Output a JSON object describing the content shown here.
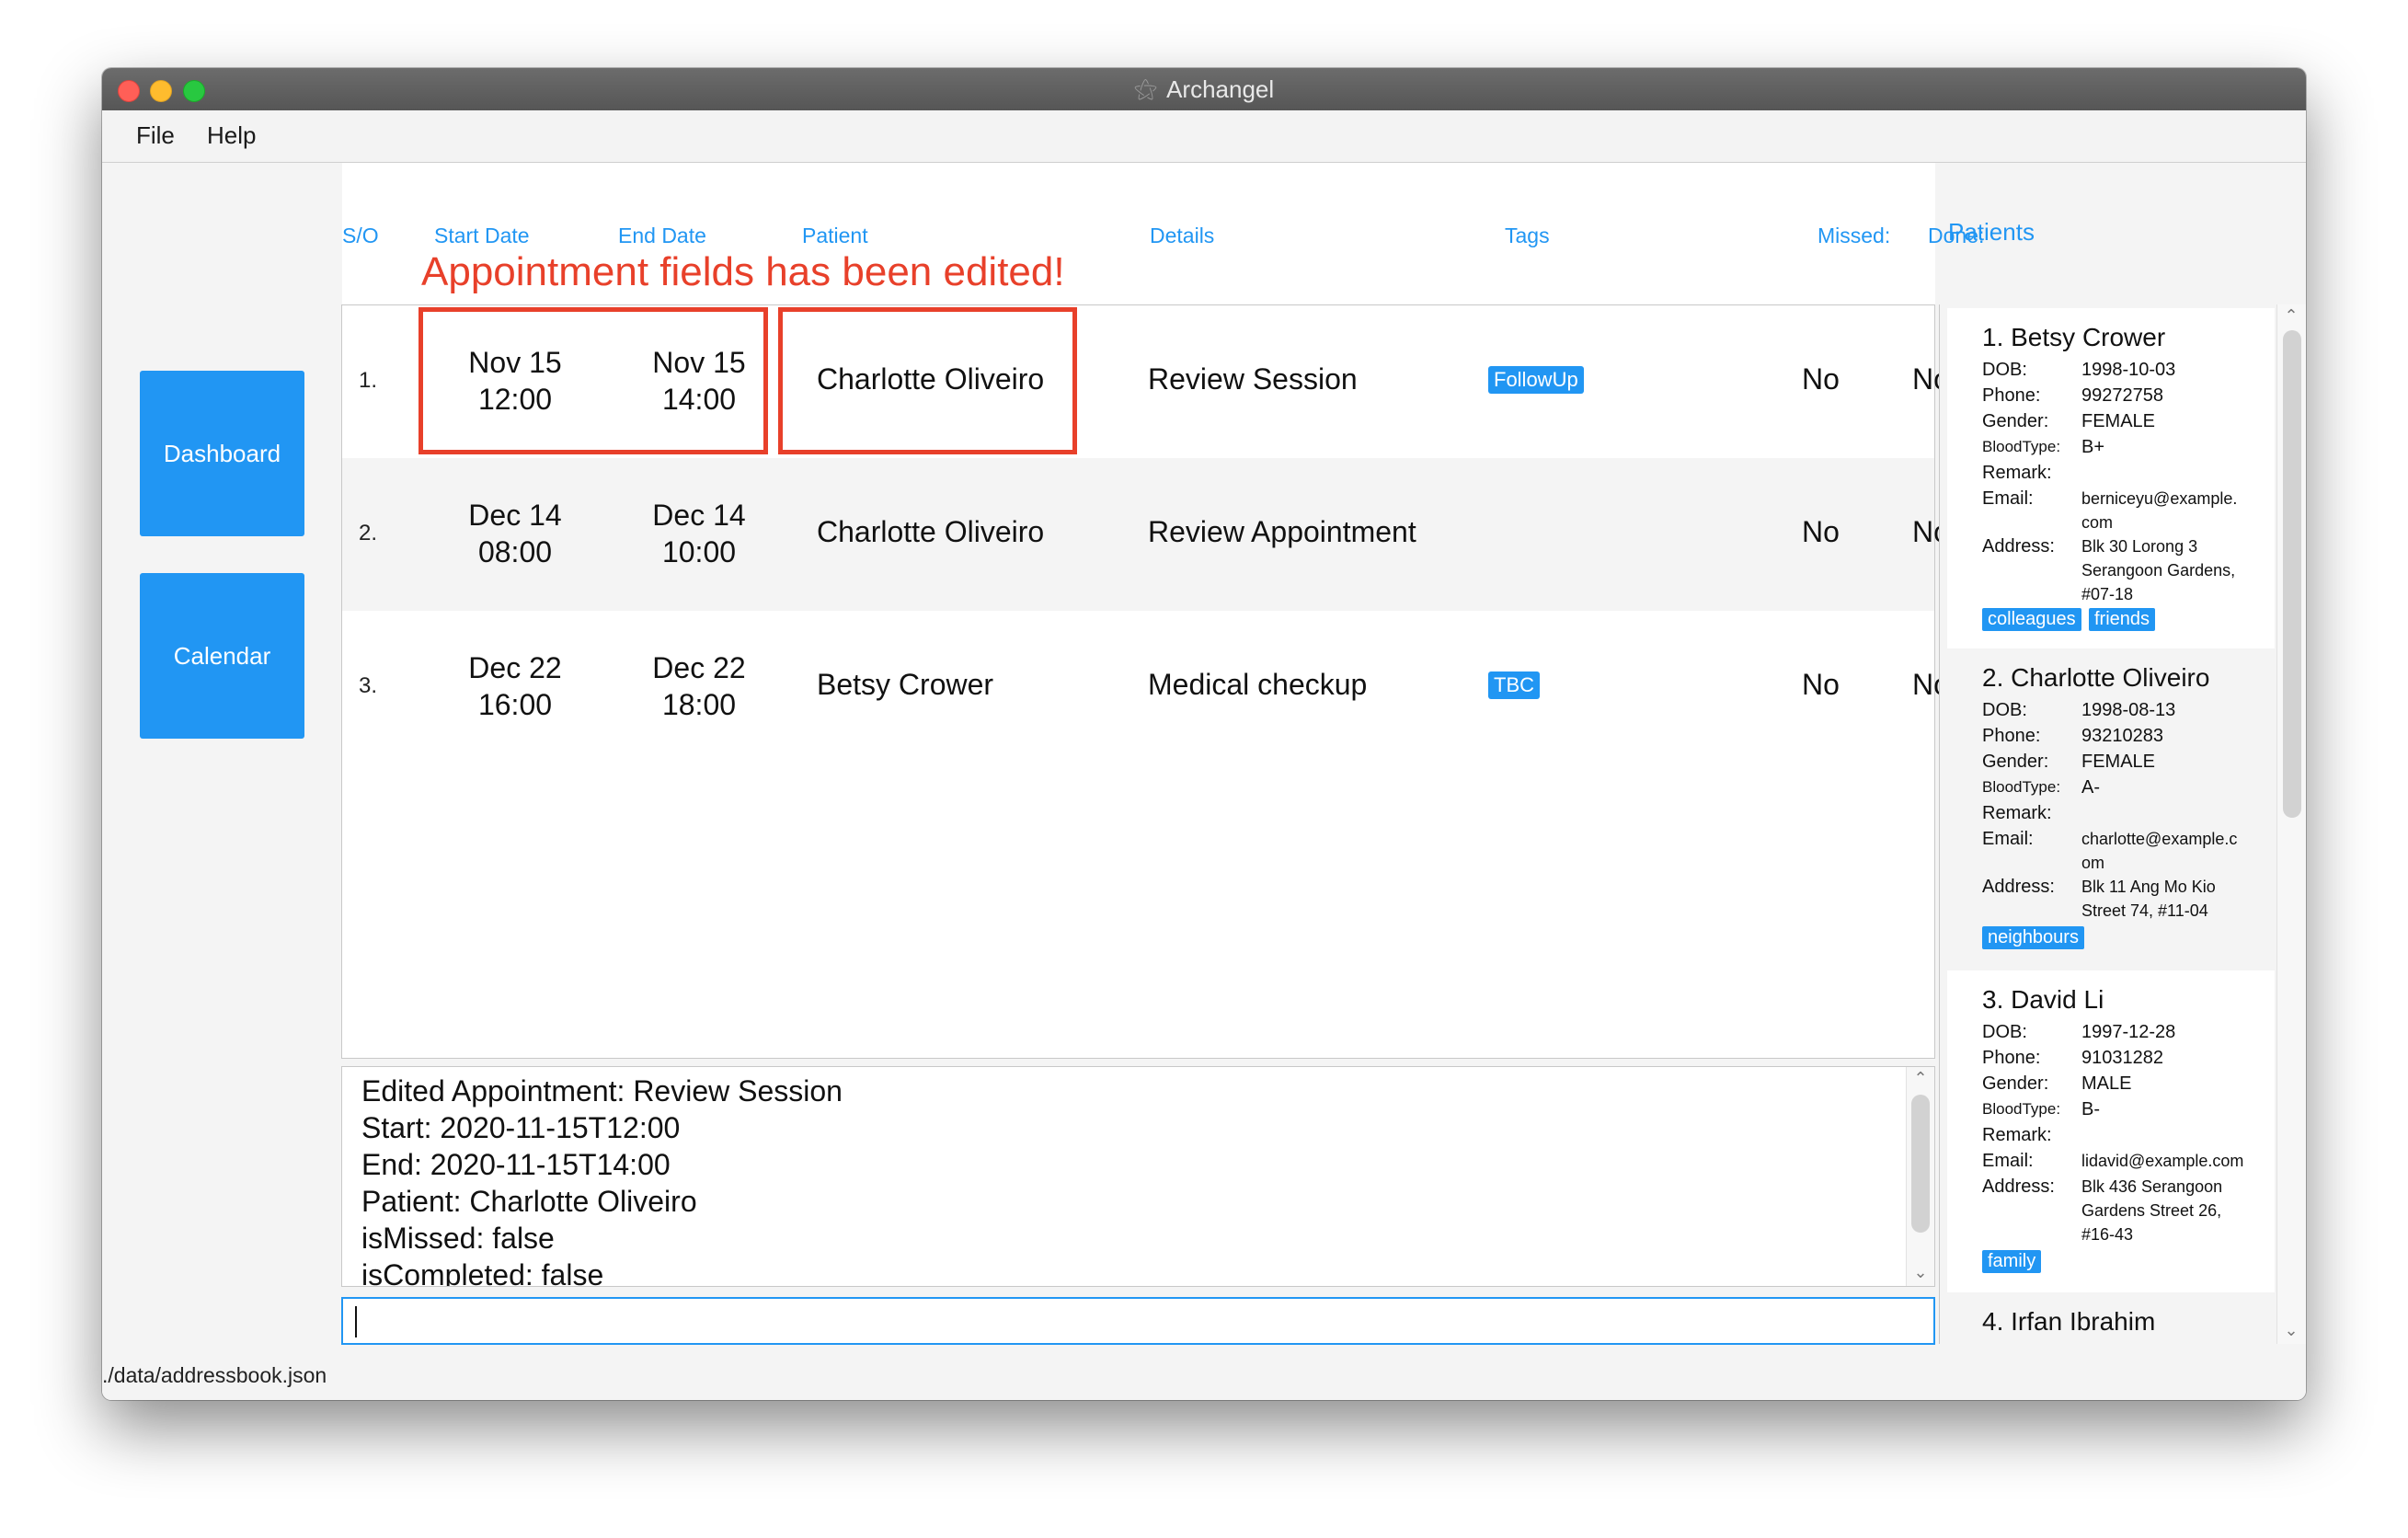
{
  "window": {
    "title": "Archangel"
  },
  "menu": {
    "file": "File",
    "help": "Help"
  },
  "nav": {
    "dashboard": "Dashboard",
    "calendar": "Calendar"
  },
  "columns": {
    "so": "S/O",
    "start": "Start Date",
    "end": "End Date",
    "patient": "Patient",
    "details": "Details",
    "tags": "Tags",
    "missed": "Missed:",
    "done": "Done:"
  },
  "annotation": "Appointment fields has been edited!",
  "appointments": [
    {
      "index": "1.",
      "start_date": "Nov 15",
      "start_time": "12:00",
      "end_date": "Nov 15",
      "end_time": "14:00",
      "patient": "Charlotte Oliveiro",
      "details": "Review Session",
      "tag": "FollowUp",
      "missed": "No",
      "done": "No"
    },
    {
      "index": "2.",
      "start_date": "Dec 14",
      "start_time": "08:00",
      "end_date": "Dec 14",
      "end_time": "10:00",
      "patient": "Charlotte Oliveiro",
      "details": "Review Appointment",
      "tag": "",
      "missed": "No",
      "done": "No"
    },
    {
      "index": "3.",
      "start_date": "Dec 22",
      "start_time": "16:00",
      "end_date": "Dec 22",
      "end_time": "18:00",
      "patient": "Betsy Crower",
      "details": "Medical checkup",
      "tag": "TBC",
      "missed": "No",
      "done": "No"
    }
  ],
  "result": {
    "lines": [
      "Edited Appointment: Review Session",
      "Start: 2020-11-15T12:00",
      "End: 2020-11-15T14:00",
      "Patient: Charlotte Oliveiro",
      "isMissed: false",
      "isCompleted: false"
    ]
  },
  "command": {
    "value": ""
  },
  "status": {
    "path": "./data/addressbook.json"
  },
  "patients": {
    "header": "Patients",
    "labels": {
      "dob": "DOB:",
      "phone": "Phone:",
      "gender": "Gender:",
      "bloodtype": "BloodType:",
      "remark": "Remark:",
      "email": "Email:",
      "address": "Address:"
    },
    "items": [
      {
        "name": "1. Betsy Crower",
        "dob": "1998-10-03",
        "phone": "99272758",
        "gender": "FEMALE",
        "bloodtype": "B+",
        "email_1": "berniceyu@example.",
        "email_2": "com",
        "address_1": "Blk 30 Lorong 3",
        "address_2": "Serangoon Gardens,",
        "address_3": "#07-18",
        "tags": [
          "colleagues",
          "friends"
        ]
      },
      {
        "name": "2. Charlotte Oliveiro",
        "dob": "1998-08-13",
        "phone": "93210283",
        "gender": "FEMALE",
        "bloodtype": "A-",
        "email_1": "charlotte@example.c",
        "email_2": "om",
        "address_1": "Blk 11 Ang Mo Kio",
        "address_2": "Street 74, #11-04",
        "tags": [
          "neighbours"
        ]
      },
      {
        "name": "3. David Li",
        "dob": "1997-12-28",
        "phone": "91031282",
        "gender": "MALE",
        "bloodtype": "B-",
        "email_1": "lidavid@example.com",
        "address_1": "Blk 436 Serangoon",
        "address_2": "Gardens Street 26,",
        "address_3": "#16-43",
        "tags": [
          "family"
        ]
      },
      {
        "name": "4. Irfan Ibrahim"
      }
    ]
  },
  "colors": {
    "accent": "#2196f3",
    "annotation": "#e8402a"
  }
}
